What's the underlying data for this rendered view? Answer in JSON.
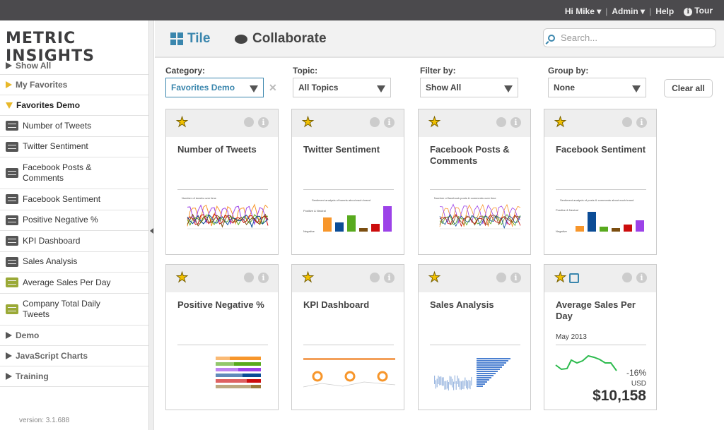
{
  "topbar": {
    "user": "Hi Mike ▾",
    "admin": "Admin ▾",
    "sep": "|",
    "help": "Help",
    "tour": "Tour",
    "tour_icon": "info-icon"
  },
  "logo": {
    "text": "METRIC INSIGHTS"
  },
  "header": {
    "tabs": [
      {
        "label": "Tile",
        "icon": "grid-icon",
        "active": true
      },
      {
        "label": "Collaborate",
        "icon": "chat-icon"
      }
    ],
    "search_placeholder": "Search..."
  },
  "sidebar": {
    "groups_top": [
      {
        "label": "Show All"
      },
      {
        "label": "My Favorites"
      },
      {
        "label": "Favorites Demo",
        "expanded": true
      }
    ],
    "items": [
      {
        "label": "Number of Tweets",
        "icon": "chart-icon"
      },
      {
        "label": "Twitter Sentiment",
        "icon": "chart-icon"
      },
      {
        "label": "Facebook Posts & Comments",
        "icon": "chart-icon"
      },
      {
        "label": "Facebook Sentiment",
        "icon": "chart-icon"
      },
      {
        "label": "Positive Negative %",
        "icon": "chart-icon"
      },
      {
        "label": "KPI Dashboard",
        "icon": "chart-icon"
      },
      {
        "label": "Sales Analysis",
        "icon": "chart-icon"
      },
      {
        "label": "Average Sales Per Day",
        "icon": "metric-icon"
      },
      {
        "label": "Company Total Daily Tweets",
        "icon": "metric-icon"
      }
    ],
    "groups_bottom": [
      {
        "label": "Demo"
      },
      {
        "label": "JavaScript Charts"
      },
      {
        "label": "Training"
      }
    ],
    "version": "version: 3.1.688"
  },
  "filters": {
    "category": {
      "label": "Category:",
      "value": "Favorites Demo"
    },
    "topic": {
      "label": "Topic:",
      "value": "All Topics"
    },
    "filter_by": {
      "label": "Filter by:",
      "value": "Show All"
    },
    "group_by": {
      "label": "Group by:",
      "value": "None"
    },
    "clear_label": "Clear all",
    "clear_x": "✕"
  },
  "tiles": [
    {
      "title": "Number of Tweets",
      "caption": "Number of tweets over time"
    },
    {
      "title": "Twitter Sentiment",
      "caption": "Sentiment analysis of tweets about each brand",
      "pos": "Positive & Neutral",
      "neg": "Negative"
    },
    {
      "title": "Facebook Posts & Comments",
      "caption": "Number of facebook posts & comments over time"
    },
    {
      "title": "Facebook Sentiment",
      "caption": "Sentiment analysis of posts & comments about each brand",
      "pos": "Positive & Neutral",
      "neg": "Negative"
    },
    {
      "title": "Positive Negative %"
    },
    {
      "title": "KPI Dashboard"
    },
    {
      "title": "Sales Analysis"
    },
    {
      "title": "Average Sales Per Day",
      "period": "May 2013",
      "change": "-16%",
      "currency": "USD",
      "value": "$10,158"
    }
  ],
  "colors": {
    "accent": "#3a86ad",
    "star": "#f2c100",
    "sparkline": "#2dbb4e",
    "bars": [
      "#f7962b",
      "#0b4c96",
      "#58aa1e",
      "#7b4e10",
      "#cc0d0d",
      "#9c42e8"
    ]
  }
}
